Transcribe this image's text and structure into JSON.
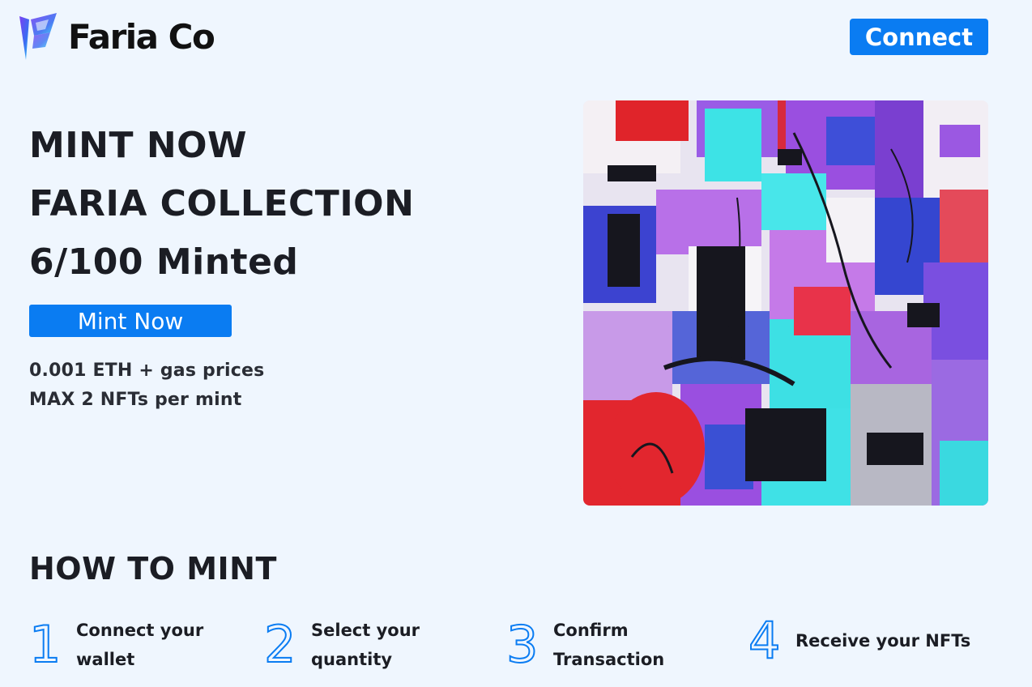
{
  "header": {
    "brand_name": "Faria Co",
    "connect_label": "Connect"
  },
  "hero": {
    "line1": "MINT NOW",
    "line2": "FARIA COLLECTION",
    "line3": "6/100 Minted",
    "mint_button_label": "Mint Now",
    "price_text": "0.001 ETH + gas prices",
    "limit_text": "MAX 2 NFTs per mint"
  },
  "how_to_mint": {
    "title": "HOW TO MINT",
    "steps": [
      {
        "number": "1",
        "label": "Connect your\nwallet"
      },
      {
        "number": "2",
        "label": "Select your\nquantity"
      },
      {
        "number": "3",
        "label": "Confirm\nTransaction"
      },
      {
        "number": "4",
        "label": "Receive your NFTs"
      }
    ]
  },
  "colors": {
    "background": "#eff6fe",
    "accent": "#0a7cf2",
    "text": "#1b1d24"
  },
  "icons": {
    "logo": "faria-logo-icon"
  }
}
